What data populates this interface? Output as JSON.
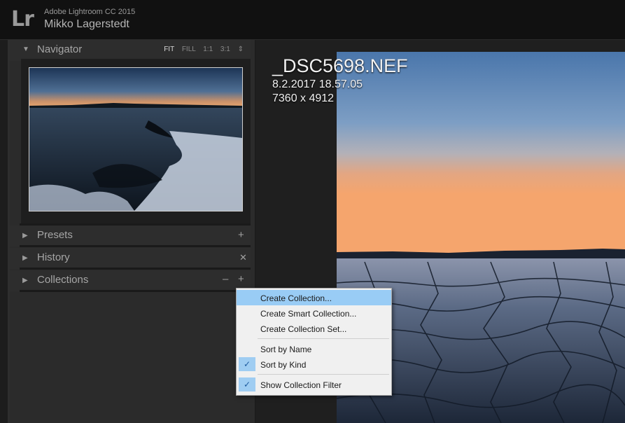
{
  "titlebar": {
    "logo": "Lr",
    "app_name": "Adobe Lightroom CC 2015",
    "user_name": "Mikko Lagerstedt"
  },
  "left_panel": {
    "navigator": {
      "title": "Navigator",
      "zoom_options": [
        "FIT",
        "FILL",
        "1:1",
        "3:1"
      ],
      "zoom_active": "FIT",
      "zoom_arrow": "⇕"
    },
    "presets": {
      "title": "Presets",
      "action": "+"
    },
    "history": {
      "title": "History",
      "action": "✕"
    },
    "collections": {
      "title": "Collections",
      "action_minus": "–",
      "action_plus": "+"
    }
  },
  "image_info": {
    "filename": "_DSC5698.NEF",
    "datetime": "8.2.2017 18.57.05",
    "dimensions": "7360 x 4912"
  },
  "context_menu": {
    "items": [
      {
        "label": "Create Collection...",
        "highlighted": true,
        "checked": false
      },
      {
        "label": "Create Smart Collection...",
        "highlighted": false,
        "checked": false
      },
      {
        "label": "Create Collection Set...",
        "highlighted": false,
        "checked": false
      },
      {
        "label": "Sort by Name",
        "highlighted": false,
        "checked": false
      },
      {
        "label": "Sort by Kind",
        "highlighted": false,
        "checked": true
      },
      {
        "label": "Show Collection Filter",
        "highlighted": false,
        "checked": true
      }
    ],
    "check_glyph": "✓"
  },
  "colors": {
    "panel_bg": "#2b2b2b",
    "menu_highlight": "#99ccf5",
    "sky_top": "#4d7bb0",
    "sunset": "#f0a070"
  }
}
